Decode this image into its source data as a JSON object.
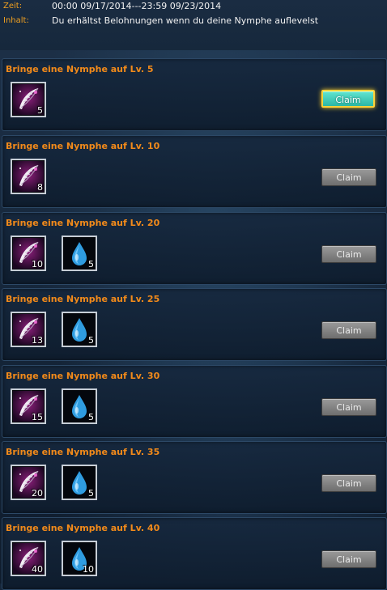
{
  "header": {
    "time_label": "Zeit:",
    "time_value": "00:00 09/17/2014---23:59 09/23/2014",
    "content_label": "Inhalt:",
    "content_value": "Du erhältst Belohnungen wenn du deine Nymphe auflevelst"
  },
  "colors": {
    "title": "#f28a1a",
    "label": "#f0a020",
    "active_button": "#3ccfbb"
  },
  "rewards": [
    {
      "title": "Bringe eine Nymphe auf Lv. 5",
      "button": "Claim",
      "button_state": "active",
      "items": [
        {
          "icon": "feather-icon",
          "count": "5"
        }
      ]
    },
    {
      "title": "Bringe eine Nymphe auf Lv. 10",
      "button": "Claim",
      "button_state": "disabled",
      "items": [
        {
          "icon": "feather-icon",
          "count": "8"
        }
      ]
    },
    {
      "title": "Bringe eine Nymphe auf Lv. 20",
      "button": "Claim",
      "button_state": "disabled",
      "items": [
        {
          "icon": "feather-icon",
          "count": "10"
        },
        {
          "icon": "water-drop-icon",
          "count": "5"
        }
      ]
    },
    {
      "title": "Bringe eine Nymphe auf Lv. 25",
      "button": "Claim",
      "button_state": "disabled",
      "items": [
        {
          "icon": "feather-icon",
          "count": "13"
        },
        {
          "icon": "water-drop-icon",
          "count": "5"
        }
      ]
    },
    {
      "title": "Bringe eine Nymphe auf Lv. 30",
      "button": "Claim",
      "button_state": "disabled",
      "items": [
        {
          "icon": "feather-icon",
          "count": "15"
        },
        {
          "icon": "water-drop-icon",
          "count": "5"
        }
      ]
    },
    {
      "title": "Bringe eine Nymphe auf Lv. 35",
      "button": "Claim",
      "button_state": "disabled",
      "items": [
        {
          "icon": "feather-icon",
          "count": "20"
        },
        {
          "icon": "water-drop-icon",
          "count": "5"
        }
      ]
    },
    {
      "title": "Bringe eine Nymphe auf Lv. 40",
      "button": "Claim",
      "button_state": "disabled",
      "items": [
        {
          "icon": "feather-icon",
          "count": "40"
        },
        {
          "icon": "water-drop-icon",
          "count": "10"
        }
      ]
    }
  ]
}
